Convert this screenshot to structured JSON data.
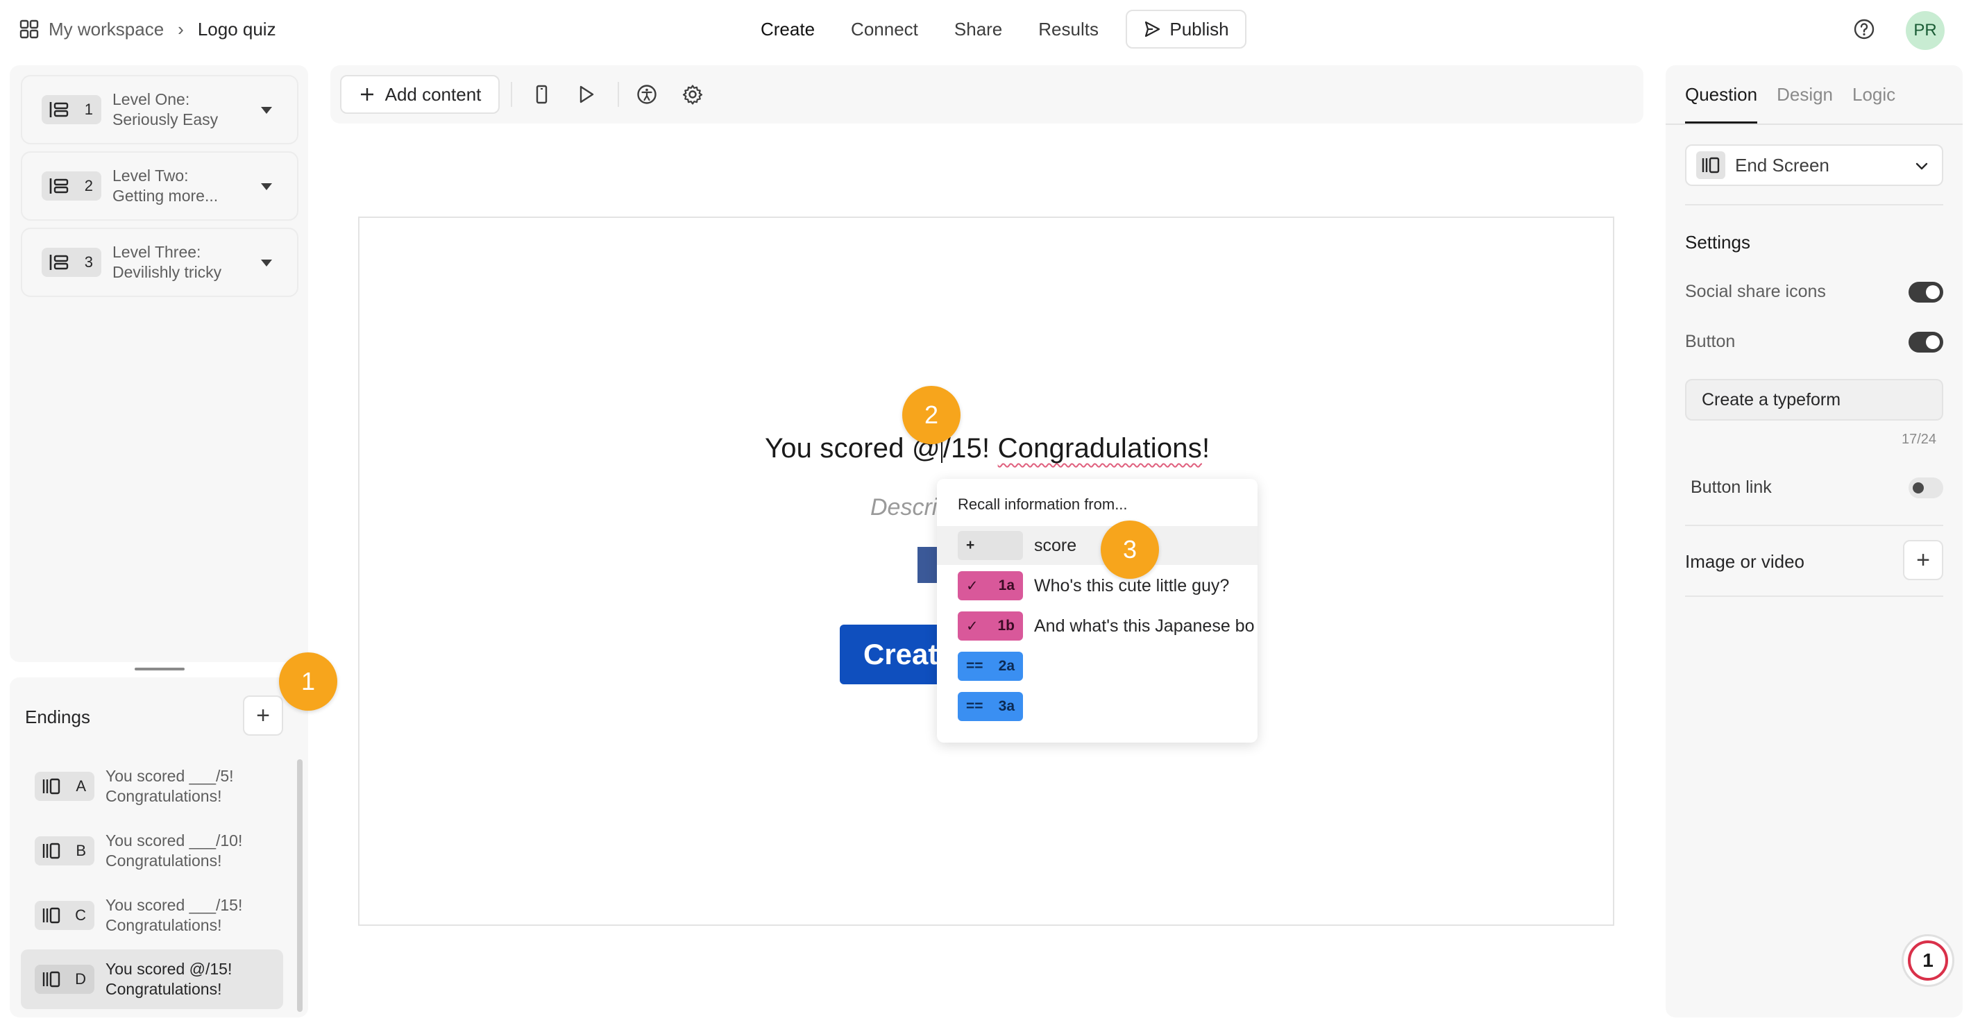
{
  "header": {
    "workspace_label": "My workspace",
    "breadcrumb_separator": "›",
    "form_name": "Logo quiz",
    "nav": [
      "Create",
      "Connect",
      "Share",
      "Results"
    ],
    "publish_label": "Publish",
    "avatar_initials": "PR"
  },
  "questions": [
    {
      "number": "1",
      "title_line1": "Level One:",
      "title_line2": "Seriously Easy"
    },
    {
      "number": "2",
      "title_line1": "Level Two:",
      "title_line2": "Getting more..."
    },
    {
      "number": "3",
      "title_line1": "Level Three:",
      "title_line2": "Devilishly tricky"
    }
  ],
  "endings": {
    "title": "Endings",
    "add_label": "+",
    "items": [
      {
        "letter": "A",
        "line1": "You scored ___/5!",
        "line2": "Congratulations!"
      },
      {
        "letter": "B",
        "line1": "You scored ___/10!",
        "line2": "Congratulations!"
      },
      {
        "letter": "C",
        "line1": "You scored ___/15!",
        "line2": "Congratulations!"
      },
      {
        "letter": "D",
        "line1": "You scored @/15!",
        "line2": "Congratulations!"
      }
    ]
  },
  "toolbar": {
    "add_content_label": "Add content"
  },
  "canvas": {
    "headline_prefix": "You scored @",
    "headline_mid": "/15! ",
    "headline_misspelled": "Congradulations",
    "headline_suffix": "!",
    "description_placeholder": "Descri",
    "create_button_label": "Create a typeform"
  },
  "recall": {
    "heading": "Recall information from...",
    "items": [
      {
        "badge_symbol": "+",
        "badge_num": "",
        "label": "score",
        "color": "gray"
      },
      {
        "badge_symbol": "✓",
        "badge_num": "1a",
        "label": "Who's this cute little guy?",
        "color": "pink"
      },
      {
        "badge_symbol": "✓",
        "badge_num": "1b",
        "label": "And what's this Japanese bo",
        "color": "pink"
      },
      {
        "badge_symbol": "==",
        "badge_num": "2a",
        "label": "",
        "color": "blue"
      },
      {
        "badge_symbol": "==",
        "badge_num": "3a",
        "label": "",
        "color": "blue"
      }
    ]
  },
  "right_panel": {
    "tabs": [
      "Question",
      "Design",
      "Logic"
    ],
    "screen_type": "End Screen",
    "settings_title": "Settings",
    "social_share_label": "Social share icons",
    "social_share_on": true,
    "button_label": "Button",
    "button_on": true,
    "button_text_value": "Create a typeform",
    "button_text_counter": "17/24",
    "button_link_label": "Button link",
    "button_link_on": false,
    "image_or_video_label": "Image or video",
    "add_media_label": "+"
  },
  "annotations": {
    "marker_1": "1",
    "marker_2": "2",
    "marker_3": "3",
    "notification_count": "1"
  },
  "colors": {
    "accent_orange": "#f7a51c",
    "recall_pink": "#d9589a",
    "recall_blue": "#3a8ff2",
    "create_button": "#0f4fbe"
  }
}
